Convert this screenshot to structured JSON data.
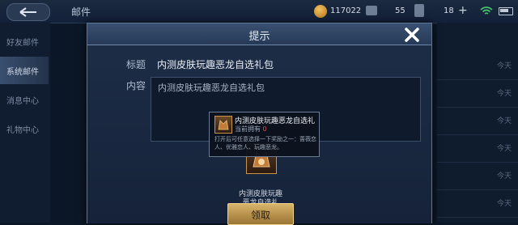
{
  "topbar": {
    "title": "邮件",
    "gold": "117022",
    "gems": "55",
    "tickets": "18",
    "plus": "+"
  },
  "sidebar": {
    "items": [
      {
        "label": "好友邮件"
      },
      {
        "label": "系统邮件"
      },
      {
        "label": "消息中心"
      },
      {
        "label": "礼物中心"
      }
    ]
  },
  "list_right": {
    "rows": [
      "今天",
      "今天",
      "今天",
      "今天",
      "今天",
      "今天"
    ]
  },
  "dialog": {
    "title": "提示",
    "label_title": "标题",
    "value_title": "内测皮肤玩趣恶龙自选礼包",
    "label_content": "内容",
    "value_content": "内测皮肤玩趣恶龙自选礼包",
    "reward_caption": "内测皮肤玩趣恶龙自选礼",
    "claim_label": "领取"
  },
  "tooltip": {
    "title": "内测皮肤玩趣恶龙自选礼",
    "owned_prefix": "当前拥有",
    "owned_count": "0",
    "description": "打开后可任意选择一下奖励之一：蔷薇恋人、优雅恋人、玩趣恶龙。"
  },
  "colors": {
    "accent_gold": "#d7b46a",
    "owned_red": "#e05050",
    "panel_blue": "#1e2e47"
  }
}
